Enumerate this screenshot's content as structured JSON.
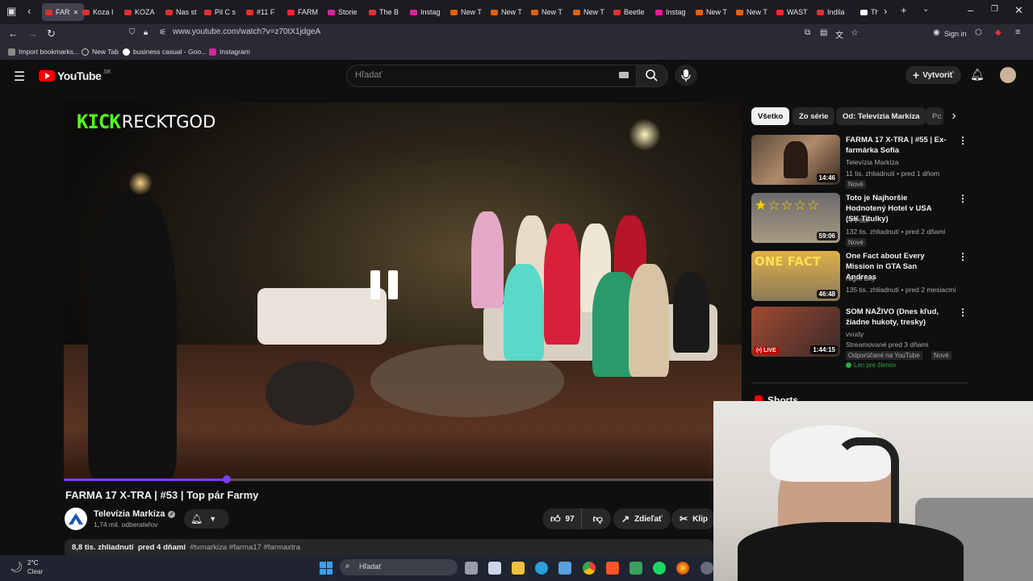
{
  "browser": {
    "tabs": [
      {
        "label": "FAR",
        "fav": "#e03030",
        "active": true
      },
      {
        "label": "Koza I",
        "fav": "#e03030"
      },
      {
        "label": "KOZA",
        "fav": "#e03030"
      },
      {
        "label": "Nas st",
        "fav": "#e03030"
      },
      {
        "label": "Pil C s",
        "fav": "#e03030"
      },
      {
        "label": "#11 F",
        "fav": "#e03030"
      },
      {
        "label": "FARM",
        "fav": "#e03030"
      },
      {
        "label": "Storie",
        "fav": "#d6249f"
      },
      {
        "label": "The B",
        "fav": "#e03030"
      },
      {
        "label": "Instag",
        "fav": "#d6249f"
      },
      {
        "label": "New T",
        "fav": "#e66000"
      },
      {
        "label": "New T",
        "fav": "#e66000"
      },
      {
        "label": "New T",
        "fav": "#e66000"
      },
      {
        "label": "New T",
        "fav": "#e66000"
      },
      {
        "label": "Beetle",
        "fav": "#e03030"
      },
      {
        "label": "Instag",
        "fav": "#d6249f"
      },
      {
        "label": "New T",
        "fav": "#e66000"
      },
      {
        "label": "New T",
        "fav": "#e66000"
      },
      {
        "label": "WAST",
        "fav": "#e03030"
      },
      {
        "label": "Indila",
        "fav": "#e03030"
      },
      {
        "label": "Th",
        "fav": "#ffffff"
      }
    ],
    "url": "www.youtube.com/watch?v=z70tX1jdgeA",
    "sign_in": "Sign in",
    "bookmarks": [
      {
        "label": "Import bookmarks...",
        "icon": "import-icon"
      },
      {
        "label": "New Tab",
        "icon": "globe-icon"
      },
      {
        "label": "business casual - Goo...",
        "icon": "google-icon"
      },
      {
        "label": "Instagram",
        "icon": "instagram-icon"
      }
    ]
  },
  "header": {
    "logo_text": "YouTube",
    "region": "SK",
    "search_placeholder": "Hľadať",
    "create_label": "Vytvoriť"
  },
  "player": {
    "watermark": "RECKTGOD",
    "watermark_brand": "KICK",
    "progress": 0.25
  },
  "video": {
    "title": "FARMA 17 X-TRA | #53 | Top pár Farmy",
    "channel": "Televízia Markíza",
    "subscribers": "1,74 mil. odberateľov",
    "likes": "97",
    "share_label": "Zdieľať",
    "clip_label": "Klip",
    "views": "8,8 tis. zhliadnutí",
    "posted": "pred 4 dňami",
    "tags": "#tvmarkiza #farma17 #farmaxtra"
  },
  "chips": [
    "Všetko",
    "Zo série",
    "Od: Televízia Markíza",
    "Pc"
  ],
  "recommendations": [
    {
      "title": "FARMA 17 X-TRA | #55 | Ex-farmárka Sofia",
      "channel": "Televízia Markíza",
      "meta": "11 tis. zhliadnutí • pred 1 dňom",
      "badge": "Nové",
      "duration": "14:46",
      "thumb_color": "#7a5a48"
    },
    {
      "title": "Toto je Najhoršie Hodnotený Hotel v USA (SK Titulky)",
      "channel": "PPPiter",
      "meta": "132 tis. zhliadnutí • pred 2 dňami",
      "badge": "Nové",
      "duration": "59:06",
      "thumb_color": "#8a8478"
    },
    {
      "title": "One Fact about Every Mission in GTA San Andreas",
      "channel": "Night Sky",
      "meta": "135 tis. zhliadnutí • pred 2 mesiacmi",
      "badge": "",
      "duration": "46:48",
      "thumb_color": "#c9a04a"
    },
    {
      "title": "SOM NAŽIVO (Dnes kľud, žiadne hukoty, tresky)",
      "channel": "vvudy",
      "meta": "Streamované pred 3 dňami",
      "badge": "Odporúčané na YouTube",
      "badge2": "Nové",
      "extra": "Len pre členov",
      "duration": "1:44:15",
      "live": "LIVE",
      "thumb_color": "#6a3a2a"
    }
  ],
  "shorts_label": "Shorts",
  "taskbar": {
    "temp": "2°C",
    "weather": "Clear",
    "search_placeholder": "Hľadať"
  },
  "colors": {
    "accent": "#7b3ff2",
    "youtube_red": "#ff0000",
    "kick_green": "#53fc18"
  }
}
